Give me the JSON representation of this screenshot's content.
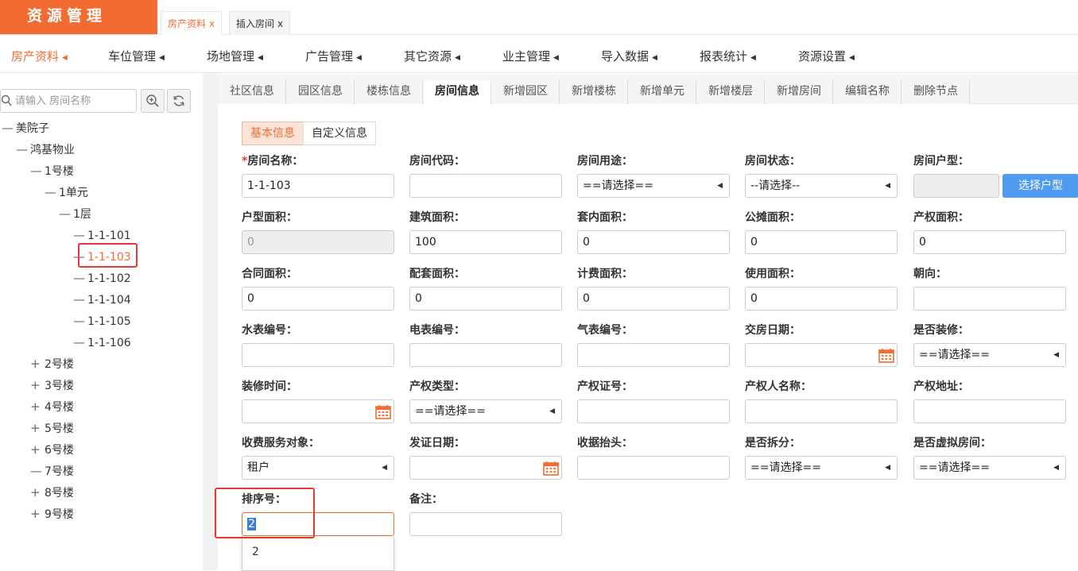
{
  "app": {
    "title": "资源管理"
  },
  "page_tabs": [
    {
      "label": "房产资料",
      "close": "x"
    },
    {
      "label": "插入房间",
      "close": "x"
    }
  ],
  "menu": [
    {
      "label": "房产资料"
    },
    {
      "label": "车位管理"
    },
    {
      "label": "场地管理"
    },
    {
      "label": "广告管理"
    },
    {
      "label": "其它资源"
    },
    {
      "label": "业主管理"
    },
    {
      "label": "导入数据"
    },
    {
      "label": "报表统计"
    },
    {
      "label": "资源设置"
    }
  ],
  "tree": {
    "search_placeholder": "请输入 房间名称",
    "nodes": [
      {
        "sym": "—",
        "label": "美院子"
      },
      {
        "sym": "—",
        "label": "鸿基物业"
      },
      {
        "sym": "—",
        "label": "1号楼"
      },
      {
        "sym": "—",
        "label": "1单元"
      },
      {
        "sym": "—",
        "label": "1层"
      },
      {
        "sym": "—",
        "label": "1-1-101"
      },
      {
        "sym": "—",
        "label": "1-1-103"
      },
      {
        "sym": "—",
        "label": "1-1-102"
      },
      {
        "sym": "—",
        "label": "1-1-104"
      },
      {
        "sym": "—",
        "label": "1-1-105"
      },
      {
        "sym": "—",
        "label": "1-1-106"
      },
      {
        "sym": "+",
        "label": "2号楼"
      },
      {
        "sym": "+",
        "label": "3号楼"
      },
      {
        "sym": "+",
        "label": "4号楼"
      },
      {
        "sym": "+",
        "label": "5号楼"
      },
      {
        "sym": "+",
        "label": "6号楼"
      },
      {
        "sym": "—",
        "label": "7号楼"
      },
      {
        "sym": "+",
        "label": "8号楼"
      },
      {
        "sym": "+",
        "label": "9号楼"
      }
    ]
  },
  "subtabs": [
    {
      "label": "社区信息"
    },
    {
      "label": "园区信息"
    },
    {
      "label": "楼栋信息"
    },
    {
      "label": "房间信息"
    },
    {
      "label": "新增园区"
    },
    {
      "label": "新增楼栋"
    },
    {
      "label": "新增单元"
    },
    {
      "label": "新增楼层"
    },
    {
      "label": "新增房间"
    },
    {
      "label": "编辑名称"
    },
    {
      "label": "删除节点"
    }
  ],
  "info_tabs": {
    "basic": "基本信息",
    "custom": "自定义信息"
  },
  "required_mark": "*",
  "fields": {
    "room_name": {
      "label": "房间名称：",
      "value": "1-1-103"
    },
    "room_code": {
      "label": "房间代码：",
      "value": ""
    },
    "room_use": {
      "label": "房间用途：",
      "value": "==请选择=="
    },
    "room_status": {
      "label": "房间状态：",
      "value": "--请选择--"
    },
    "room_type": {
      "label": "房间户型：",
      "value": "",
      "button": "选择户型"
    },
    "type_area": {
      "label": "户型面积：",
      "value": "0"
    },
    "build_area": {
      "label": "建筑面积：",
      "value": "100"
    },
    "inner_area": {
      "label": "套内面积：",
      "value": "0"
    },
    "share_area": {
      "label": "公摊面积：",
      "value": "0"
    },
    "prop_area": {
      "label": "产权面积：",
      "value": "0"
    },
    "contract_area": {
      "label": "合同面积：",
      "value": "0"
    },
    "support_area": {
      "label": "配套面积：",
      "value": "0"
    },
    "fee_area": {
      "label": "计费面积：",
      "value": "0"
    },
    "use_area": {
      "label": "使用面积：",
      "value": "0"
    },
    "orientation": {
      "label": "朝向：",
      "value": ""
    },
    "water_no": {
      "label": "水表编号：",
      "value": ""
    },
    "elec_no": {
      "label": "电表编号：",
      "value": ""
    },
    "gas_no": {
      "label": "气表编号：",
      "value": ""
    },
    "delivery_date": {
      "label": "交房日期：",
      "value": ""
    },
    "decorated": {
      "label": "是否装修：",
      "value": "==请选择=="
    },
    "decor_time": {
      "label": "装修时间：",
      "value": ""
    },
    "prop_type": {
      "label": "产权类型：",
      "value": "==请选择=="
    },
    "prop_cert": {
      "label": "产权证号：",
      "value": ""
    },
    "prop_owner": {
      "label": "产权人名称：",
      "value": ""
    },
    "prop_addr": {
      "label": "产权地址：",
      "value": ""
    },
    "service_obj": {
      "label": "收费服务对象：",
      "value": "租户"
    },
    "cert_date": {
      "label": "发证日期：",
      "value": ""
    },
    "receipt_head": {
      "label": "收据抬头：",
      "value": ""
    },
    "split": {
      "label": "是否拆分：",
      "value": "==请选择=="
    },
    "virtual": {
      "label": "是否虚拟房间：",
      "value": "==请选择=="
    },
    "sort_no": {
      "label": "排序号：",
      "value": "2"
    },
    "remark": {
      "label": "备注：",
      "value": ""
    }
  },
  "autocomplete": [
    "2"
  ],
  "colors": {
    "accent": "#f26c31",
    "button_blue": "#4f9bf2",
    "highlight_red": "#e53935"
  }
}
